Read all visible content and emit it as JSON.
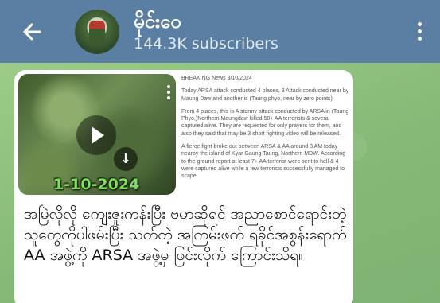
{
  "header": {
    "channel_name": "မိုင်းဝေ",
    "subscribers": "144.3K subscribers"
  },
  "post": {
    "video_overlay_date": "1-10-2024",
    "news": {
      "heading": "BREAKING News 3/10/2024",
      "paragraphs": [
        "Today ARSA attack conducted 4 places, 3 Attack conducted near by Maung Daw and another is (Taung phyo, near by zero points)",
        "From 4 places, this is A stormy attack conducted by ARSA in (Taung Phyo,)Northern Maungdaw killed 50+ AA terrorists & several captured alive. They are requested for only prayers for them, and also they said that may be 3 short fighting video will be released.",
        "A fierce fight broke out between ARSA & AA around 3 AM today nearby the island of Kyar Gaung Taung, Northern MDW. According to the ground report at least 7+ AA terrorist were sent to hell & 4 were captured alive while a few terrorists successfully managed to scape."
      ]
    },
    "caption": "အမြဲလိုလို ကျေးဇူးကန်းပြီး ဗမာဆိုရင် အညာစောင်ရောင်းတဲ့သူတွေကိုပါဖမ်းပြီး သတ်တဲ့ အကြမ်းဖက် ရခိုင်အစွန်းရောက် AA အဖွဲ့ကို ARSA အဖွဲ့မှ ဖြင်းလိုက် ကြောင်းသိရ။"
  }
}
